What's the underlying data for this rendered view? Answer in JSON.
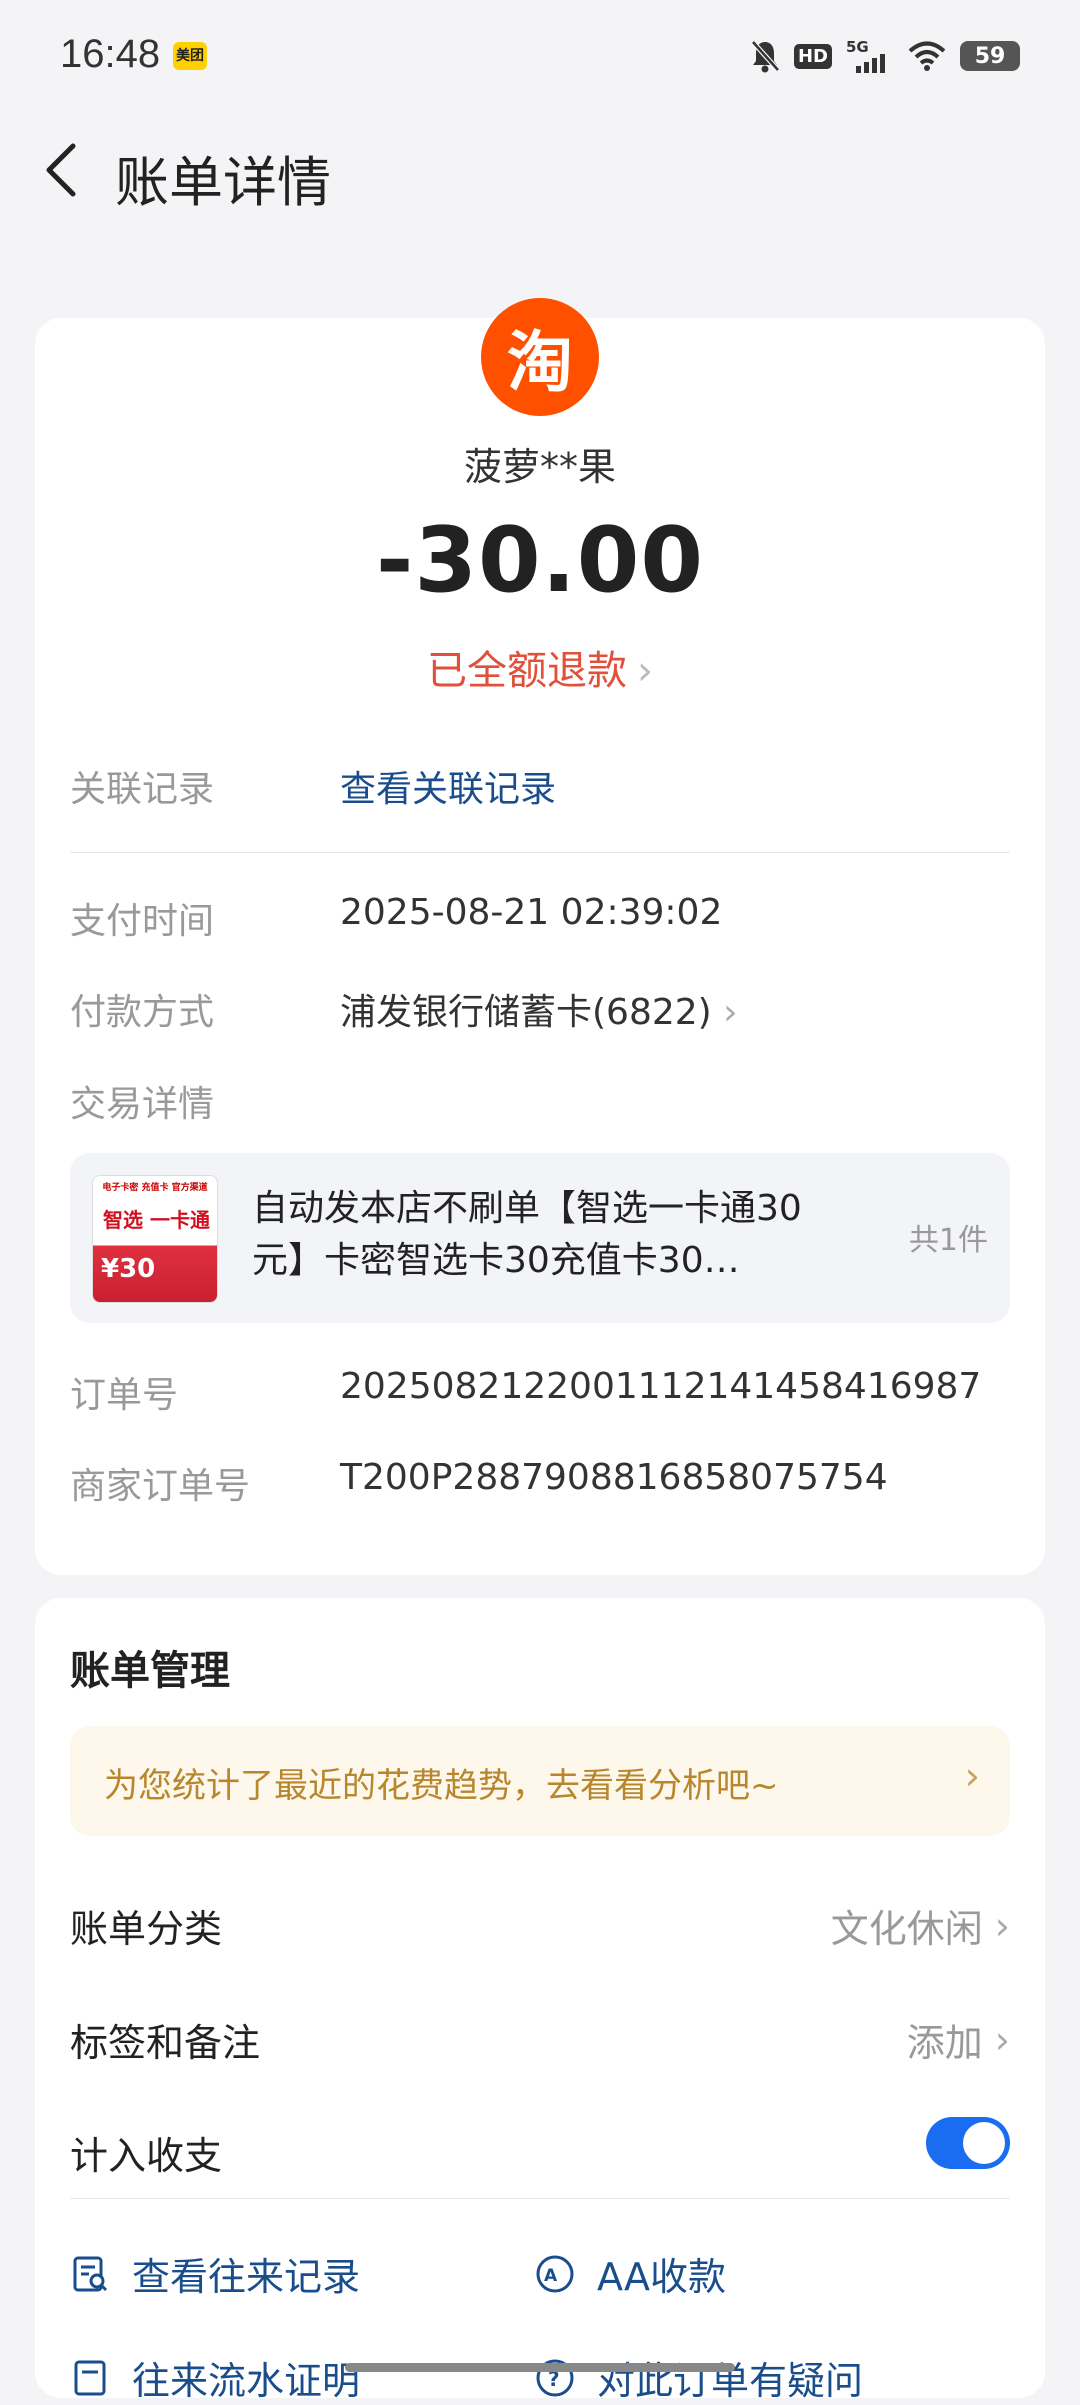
{
  "status_bar": {
    "time": "16:48",
    "app_badge": "美团",
    "network": "5G",
    "hd": "HD",
    "battery": "59"
  },
  "header": {
    "title": "账单详情"
  },
  "summary": {
    "logo_char": "淘",
    "merchant": "菠萝**果",
    "amount": "-30.00",
    "refund_status": "已全额退款"
  },
  "details": {
    "related_label": "关联记录",
    "related_link": "查看关联记录",
    "pay_time_label": "支付时间",
    "pay_time": "2025-08-21 02:39:02",
    "pay_method_label": "付款方式",
    "pay_method": "浦发银行储蓄卡(6822)",
    "trade_label": "交易详情",
    "product_name": "自动发本店不刷单【智选一卡通30元】卡密智选卡30充值卡30…",
    "product_count": "共1件",
    "thumb_top": "电子卡密 充值卡 官方渠道",
    "thumb_title": "智选 一卡通",
    "thumb_value": "¥30",
    "order_no_label": "订单号",
    "order_no": "2025082122001112141458416987",
    "merchant_order_label": "商家订单号",
    "merchant_order": "T200P2887908816858075754"
  },
  "management": {
    "title": "账单管理",
    "banner": "为您统计了最近的花费趋势，去看看分析吧~",
    "category_label": "账单分类",
    "category_value": "文化休闲",
    "tags_label": "标签和备注",
    "tags_value": "添加",
    "income_label": "计入收支",
    "income_enabled": true,
    "actions": {
      "history": "查看往来记录",
      "aa": "AA收款",
      "proof": "往来流水证明",
      "question": "对此订单有疑问"
    }
  },
  "colors": {
    "accent_blue": "#1a6cf0",
    "link_blue": "#1a4d8c",
    "refund_red": "#e0503a",
    "taobao_orange": "#ff5000"
  }
}
